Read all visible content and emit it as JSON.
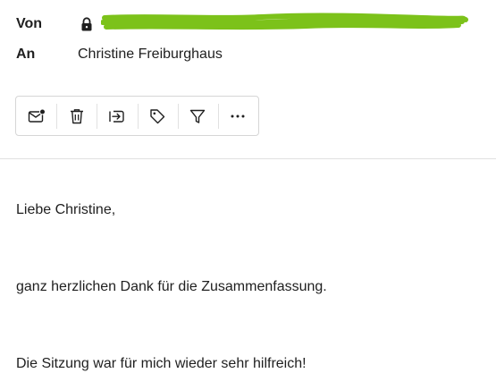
{
  "header": {
    "from_label": "Von",
    "to_label": "An",
    "to_value": "Christine Freiburghaus",
    "from_value_redacted": true,
    "icons": {
      "lock": "lock-icon"
    },
    "colors": {
      "redaction": "#7cc21a"
    }
  },
  "toolbar": {
    "buttons": [
      {
        "name": "mark-unread",
        "icon": "mail-unread-icon"
      },
      {
        "name": "delete",
        "icon": "trash-icon"
      },
      {
        "name": "move",
        "icon": "move-to-folder-icon"
      },
      {
        "name": "tag",
        "icon": "tag-icon"
      },
      {
        "name": "filter",
        "icon": "filter-icon"
      },
      {
        "name": "more",
        "icon": "more-horizontal-icon"
      }
    ]
  },
  "message": {
    "lines": [
      "Liebe Christine,",
      "ganz herzlichen Dank für die Zusammenfassung.",
      "Die Sitzung war für mich wieder sehr hilfreich!"
    ]
  }
}
